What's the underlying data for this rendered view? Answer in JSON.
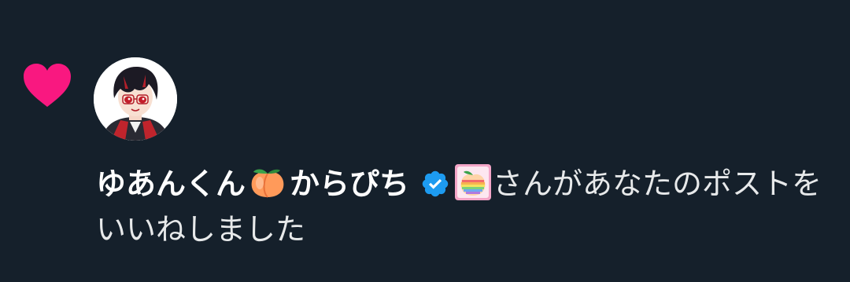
{
  "notification": {
    "type_icon": "heart-icon",
    "type_icon_color": "#f91880",
    "avatar": "user-avatar",
    "user": {
      "name_part1": "ゆあんくん",
      "name_emoji": "peach-emoji",
      "name_part2": "からぴち",
      "verified_icon": "verified-badge-icon",
      "verified_color": "#1d9bf0",
      "affiliate_icon": "rainbow-peach-badge-icon"
    },
    "action_text": "さんがあなたのポストをいいねしました"
  },
  "colors": {
    "background": "#15202b",
    "text": "#e7e9ea"
  }
}
